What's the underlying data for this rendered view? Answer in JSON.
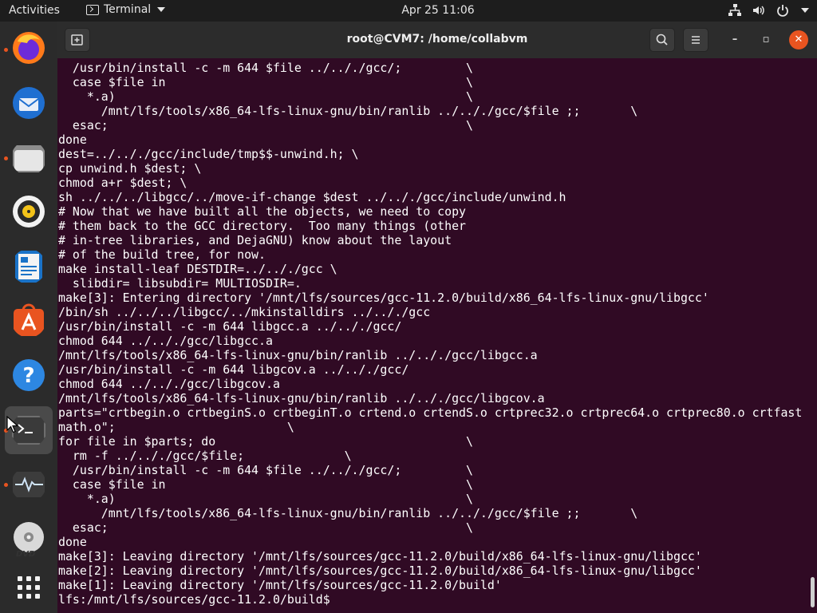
{
  "topbar": {
    "activities": "Activities",
    "app_name": "Terminal",
    "clock": "Apr 25  11:06"
  },
  "dock": {
    "items": [
      {
        "name": "firefox",
        "running": true
      },
      {
        "name": "thunderbird",
        "running": false
      },
      {
        "name": "files",
        "running": true
      },
      {
        "name": "rhythmbox",
        "running": false
      },
      {
        "name": "libreoffice-writer",
        "running": false
      },
      {
        "name": "ubuntu-software",
        "running": false
      },
      {
        "name": "help",
        "running": false
      },
      {
        "name": "terminal",
        "running": true
      },
      {
        "name": "system-monitor",
        "running": true
      },
      {
        "name": "dvd",
        "running": false
      },
      {
        "name": "show-applications",
        "running": false
      }
    ],
    "dvd_label": "DVD"
  },
  "window": {
    "title": "root@CVM7: /home/collabvm",
    "new_tab_tooltip": "New tab",
    "minimize": "–",
    "maximize": "▫",
    "close": "✕"
  },
  "terminal": {
    "lines": [
      "  /usr/bin/install -c -m 644 $file ../.././gcc/;         \\",
      "  case $file in                                          \\",
      "    *.a)                                                 \\",
      "      /mnt/lfs/tools/x86_64-lfs-linux-gnu/bin/ranlib ../.././gcc/$file ;;       \\",
      "  esac;                                                  \\",
      "done",
      "dest=../.././gcc/include/tmp$$-unwind.h; \\",
      "cp unwind.h $dest; \\",
      "chmod a+r $dest; \\",
      "sh ../../../libgcc/../move-if-change $dest ../.././gcc/include/unwind.h",
      "# Now that we have built all the objects, we need to copy",
      "# them back to the GCC directory.  Too many things (other",
      "# in-tree libraries, and DejaGNU) know about the layout",
      "# of the build tree, for now.",
      "make install-leaf DESTDIR=../.././gcc \\",
      "  slibdir= libsubdir= MULTIOSDIR=.",
      "make[3]: Entering directory '/mnt/lfs/sources/gcc-11.2.0/build/x86_64-lfs-linux-gnu/libgcc'",
      "/bin/sh ../../../libgcc/../mkinstalldirs ../.././gcc",
      "/usr/bin/install -c -m 644 libgcc.a ../.././gcc/",
      "chmod 644 ../.././gcc/libgcc.a",
      "/mnt/lfs/tools/x86_64-lfs-linux-gnu/bin/ranlib ../.././gcc/libgcc.a",
      "/usr/bin/install -c -m 644 libgcov.a ../.././gcc/",
      "chmod 644 ../.././gcc/libgcov.a",
      "/mnt/lfs/tools/x86_64-lfs-linux-gnu/bin/ranlib ../.././gcc/libgcov.a",
      "parts=\"crtbegin.o crtbeginS.o crtbeginT.o crtend.o crtendS.o crtprec32.o crtprec64.o crtprec80.o crtfast",
      "math.o\";                        \\",
      "for file in $parts; do                                   \\",
      "  rm -f ../.././gcc/$file;              \\",
      "  /usr/bin/install -c -m 644 $file ../.././gcc/;         \\",
      "  case $file in                                          \\",
      "    *.a)                                                 \\",
      "      /mnt/lfs/tools/x86_64-lfs-linux-gnu/bin/ranlib ../.././gcc/$file ;;       \\",
      "  esac;                                                  \\",
      "done",
      "make[3]: Leaving directory '/mnt/lfs/sources/gcc-11.2.0/build/x86_64-lfs-linux-gnu/libgcc'",
      "make[2]: Leaving directory '/mnt/lfs/sources/gcc-11.2.0/build/x86_64-lfs-linux-gnu/libgcc'",
      "make[1]: Leaving directory '/mnt/lfs/sources/gcc-11.2.0/build'",
      "lfs:/mnt/lfs/sources/gcc-11.2.0/build$"
    ]
  },
  "colors": {
    "terminal_bg": "#300a24",
    "accent": "#e95420"
  }
}
